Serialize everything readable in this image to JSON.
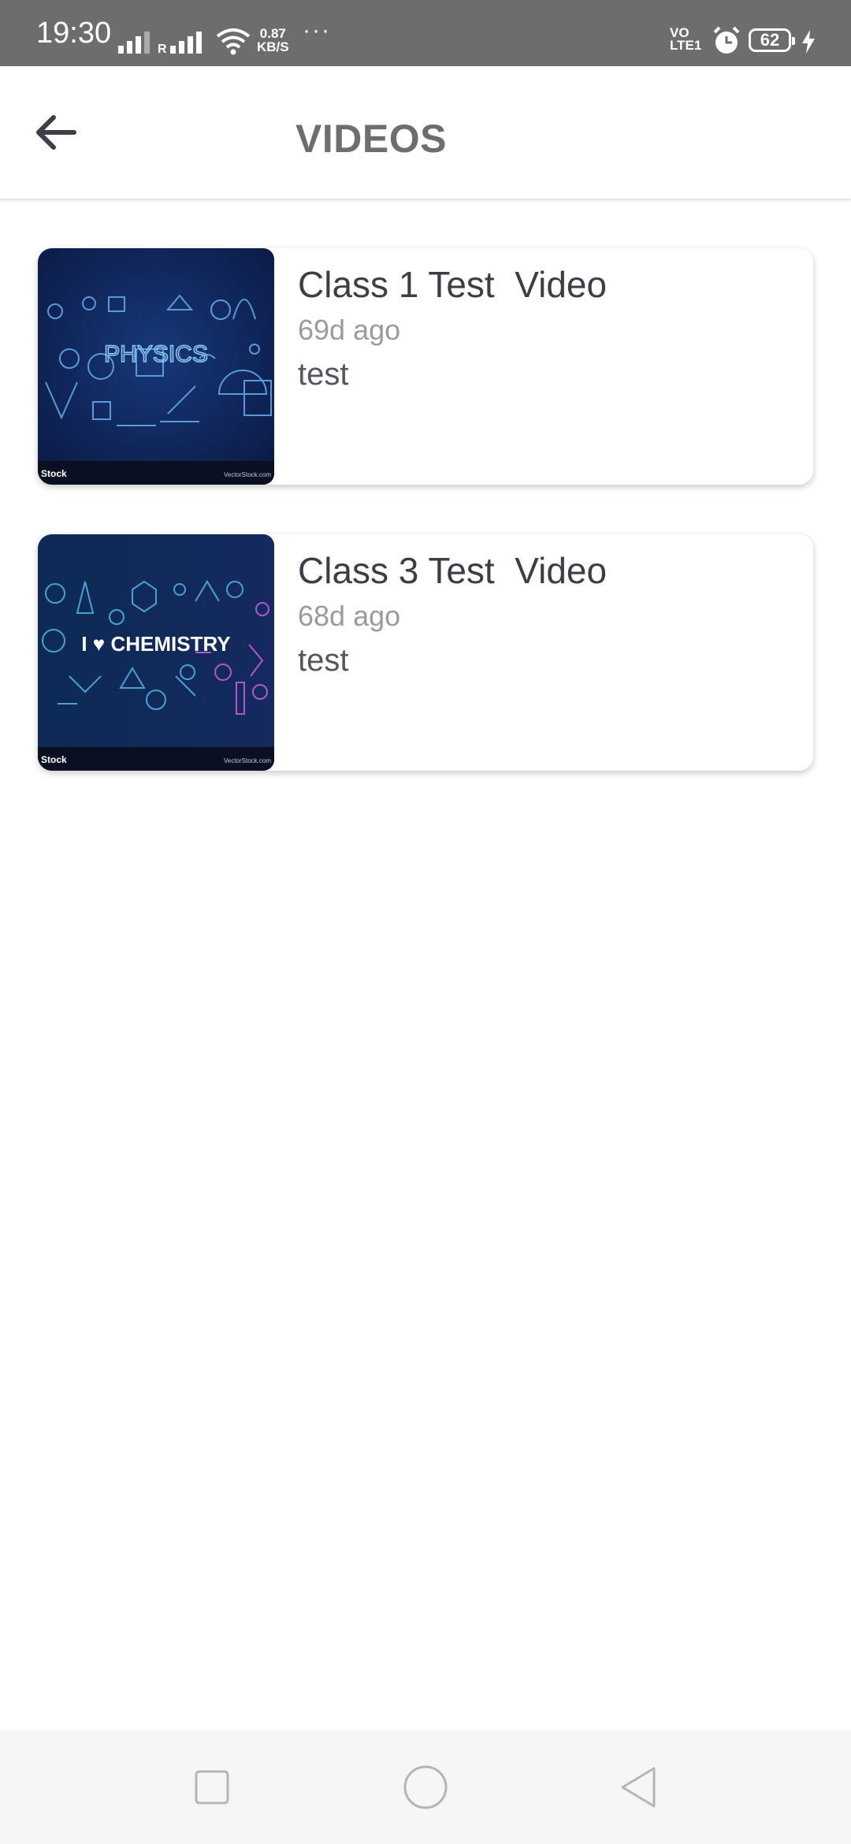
{
  "status_bar": {
    "time": "19:30",
    "network_speed_value": "0.87",
    "network_speed_unit": "KB/S",
    "more_indicator": "···",
    "volte_line1": "VO",
    "volte_line2": "LTE1",
    "battery_level": "62",
    "icons": [
      "signal-icon",
      "roaming-signal-icon",
      "wifi-icon",
      "alarm-icon",
      "battery-icon",
      "charging-icon"
    ]
  },
  "app_bar": {
    "title": "VIDEOS",
    "back_icon": "back-arrow-icon"
  },
  "videos": [
    {
      "title": "Class 1 Test  Video",
      "posted": "69d ago",
      "description": "test",
      "thumbnail_text": "PHYSICS",
      "thumbnail_watermark_left": "Stock",
      "thumbnail_watermark_right": "VectorStock.com"
    },
    {
      "title": "Class 3 Test  Video",
      "posted": "68d ago",
      "description": "test",
      "thumbnail_text": "I ♥ CHEMISTRY",
      "thumbnail_watermark_left": "Stock",
      "thumbnail_watermark_right": "VectorStock.com"
    }
  ],
  "nav_bar": {
    "buttons": [
      "recents-square-icon",
      "home-circle-icon",
      "back-triangle-icon"
    ]
  },
  "colors": {
    "status_bar_bg": "#6d6d6d",
    "title_gray": "#6e6e70",
    "card_title": "#3d3d48",
    "thumb_bg": "#0f2250"
  }
}
